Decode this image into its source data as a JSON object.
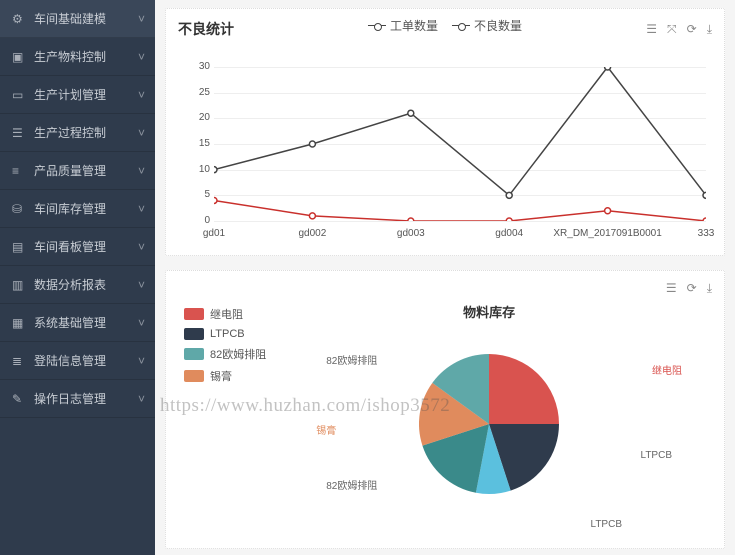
{
  "sidebar": {
    "items": [
      {
        "icon": "gear",
        "label": "车间基础建模"
      },
      {
        "icon": "cube",
        "label": "生产物料控制"
      },
      {
        "icon": "calendar",
        "label": "生产计划管理"
      },
      {
        "icon": "flow",
        "label": "生产过程控制"
      },
      {
        "icon": "list",
        "label": "产品质量管理"
      },
      {
        "icon": "truck",
        "label": "车间库存管理"
      },
      {
        "icon": "board",
        "label": "车间看板管理"
      },
      {
        "icon": "chart",
        "label": "数据分析报表"
      },
      {
        "icon": "base",
        "label": "系统基础管理"
      },
      {
        "icon": "user",
        "label": "登陆信息管理"
      },
      {
        "icon": "log",
        "label": "操作日志管理"
      }
    ]
  },
  "card1": {
    "title": "不良统计",
    "legend": {
      "s1": "工单数量",
      "s2": "不良数量"
    }
  },
  "card2": {
    "title": "物料库存",
    "legend": [
      "继电阻",
      "LTPCB",
      "82欧姆排阻",
      "锡膏"
    ],
    "labels": {
      "a": "继电阻",
      "b": "LTPCB",
      "c": "LTPCB",
      "d": "82欧姆排阻",
      "e": "锡膏",
      "f": "82欧姆排阻"
    }
  },
  "watermark": "https://www.huzhan.com/ishop3572",
  "chart_data": [
    {
      "type": "line",
      "title": "不良统计",
      "categories": [
        "gd01",
        "gd002",
        "gd003",
        "gd004",
        "XR_DM_2017091B0001",
        "333"
      ],
      "series": [
        {
          "name": "工单数量",
          "values": [
            10,
            15,
            21,
            5,
            30,
            5
          ],
          "color": "#444"
        },
        {
          "name": "不良数量",
          "values": [
            4,
            1,
            0,
            0,
            2,
            0
          ],
          "color": "#c9302c"
        }
      ],
      "ylim": [
        0,
        30
      ],
      "yticks": [
        0,
        5,
        10,
        15,
        20,
        25,
        30
      ],
      "xlabel": "",
      "ylabel": ""
    },
    {
      "type": "pie",
      "title": "物料库存",
      "slices": [
        {
          "label": "继电阻",
          "value": 25,
          "color": "#d9534f"
        },
        {
          "label": "LTPCB",
          "value": 20,
          "color": "#2f3b4c"
        },
        {
          "label": "LTPCB",
          "value": 8,
          "color": "#5bc0de"
        },
        {
          "label": "82欧姆排阻",
          "value": 17,
          "color": "#3a8a8a"
        },
        {
          "label": "锡膏",
          "value": 15,
          "color": "#e08b5d"
        },
        {
          "label": "82欧姆排阻",
          "value": 15,
          "color": "#5fa8a8"
        }
      ]
    }
  ]
}
